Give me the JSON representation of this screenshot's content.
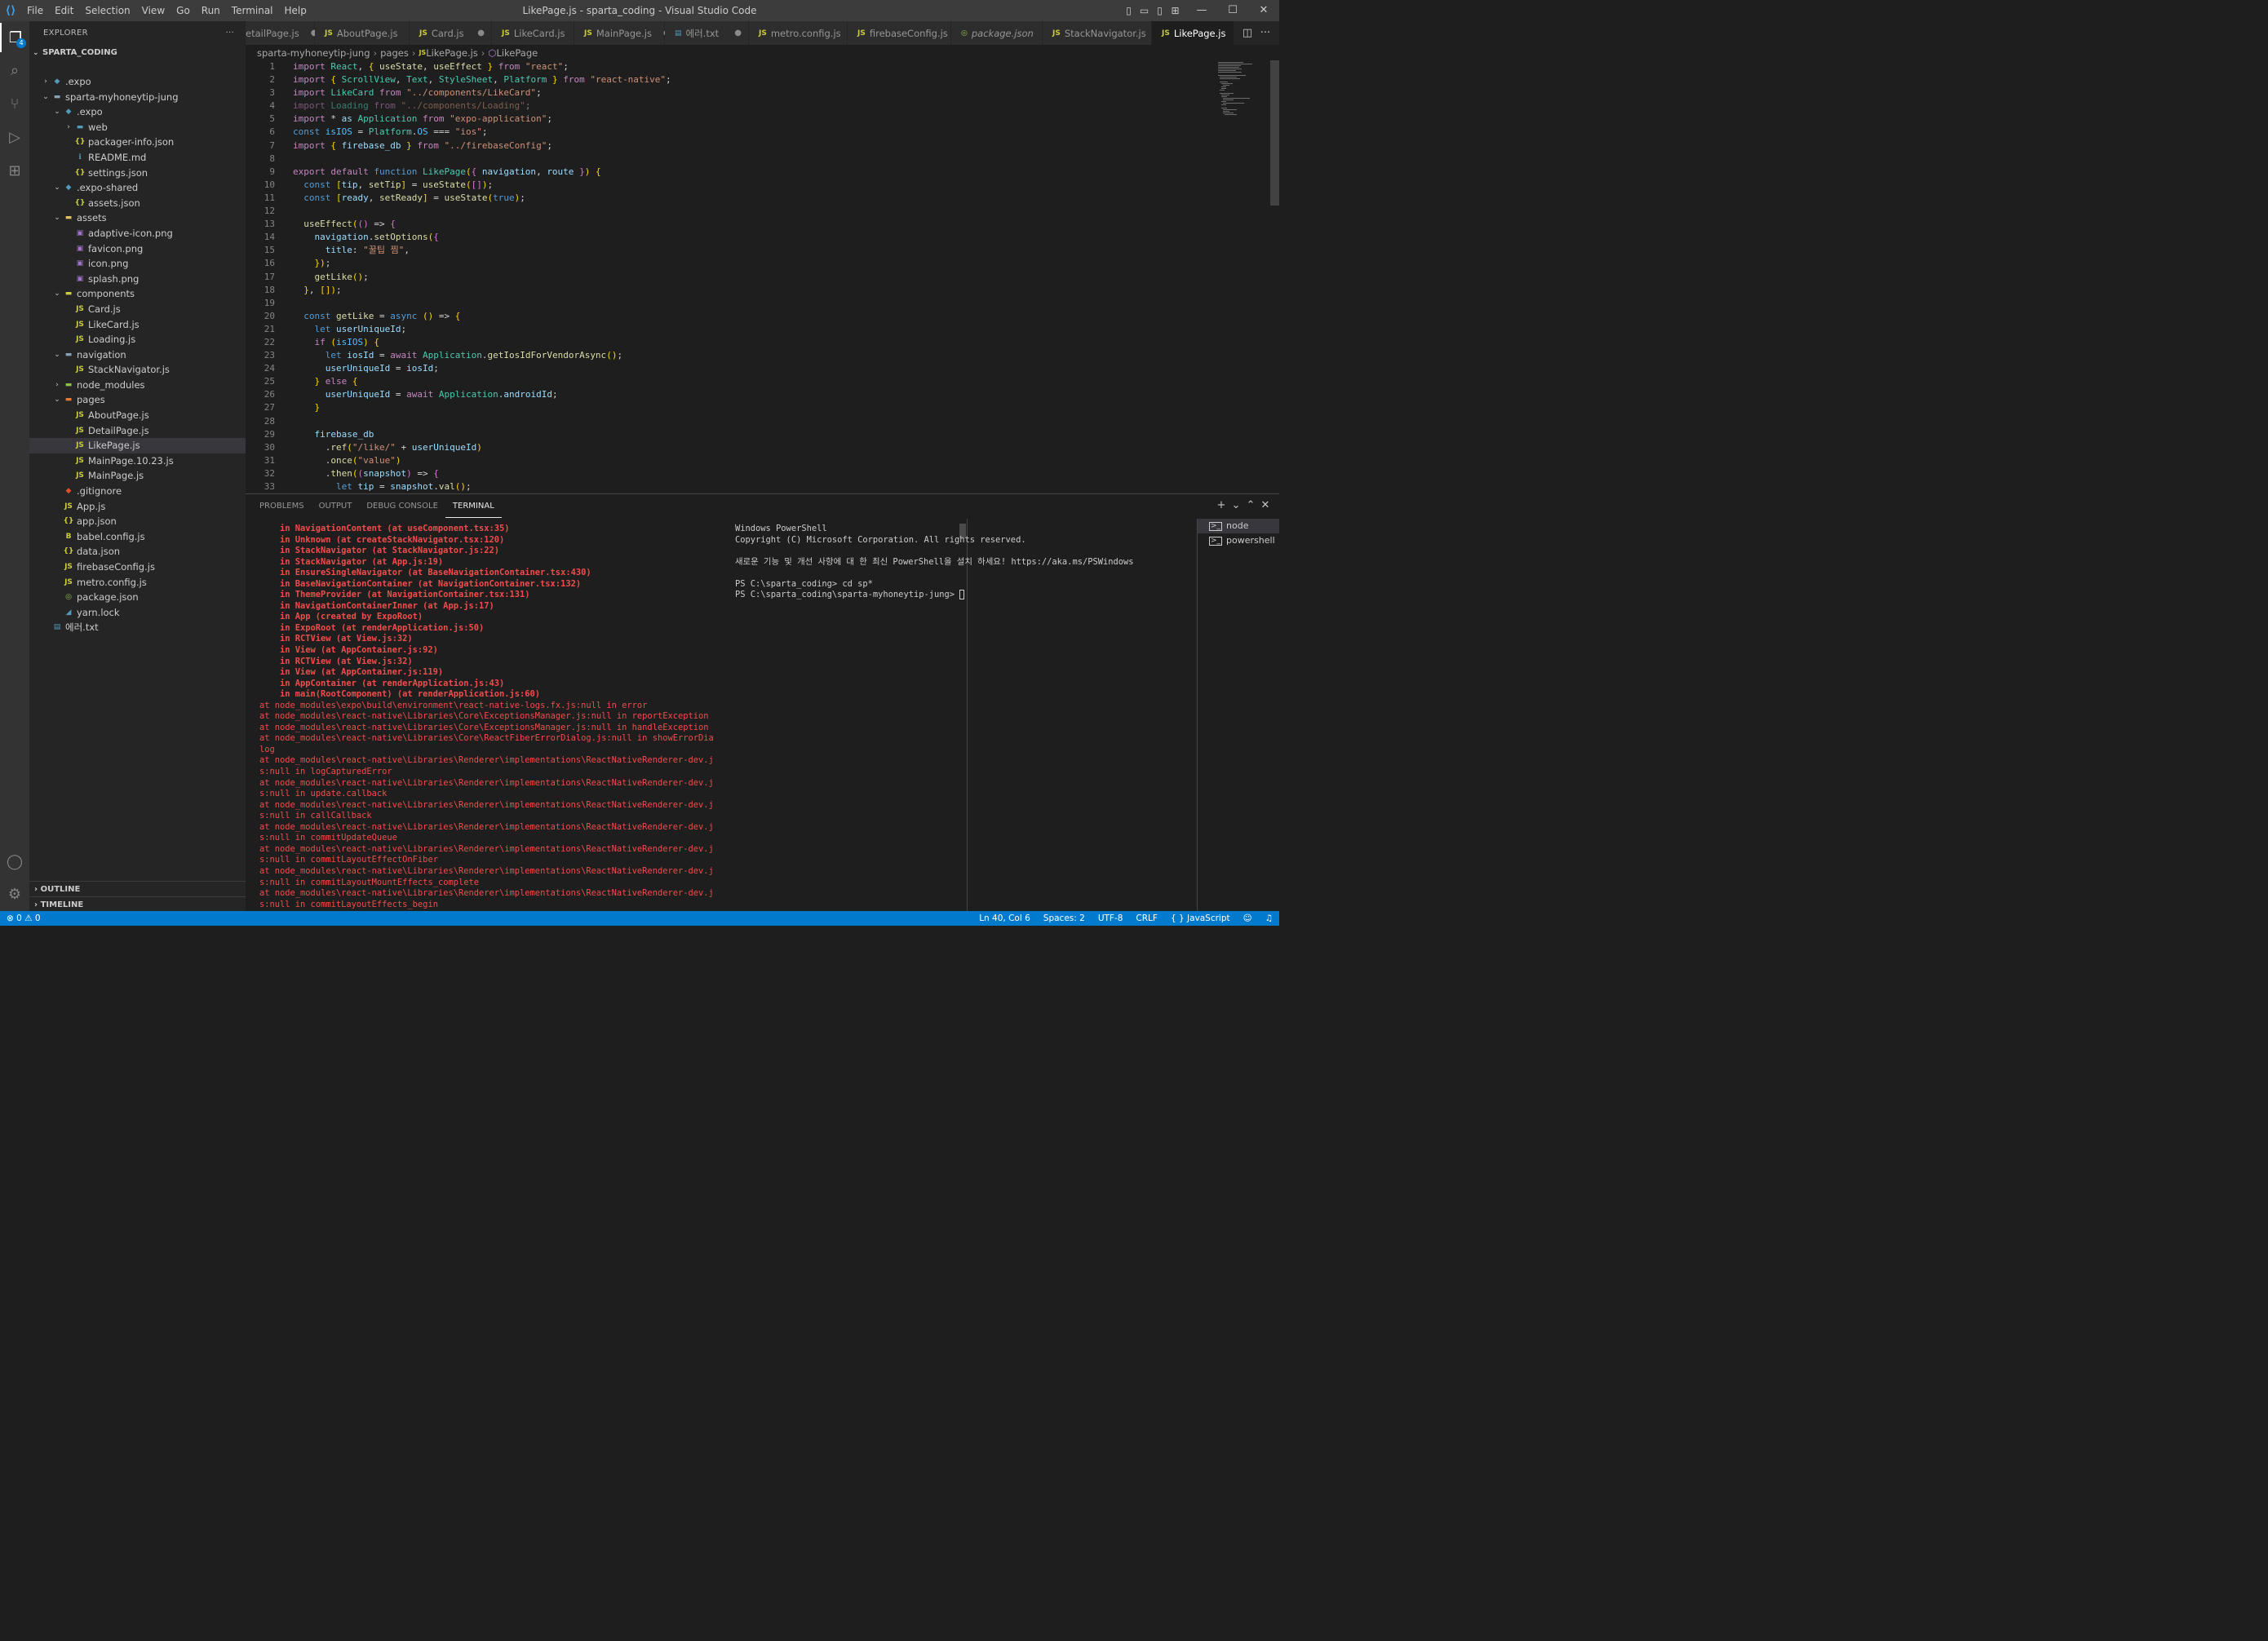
{
  "titlebar": {
    "title": "LikePage.js - sparta_coding - Visual Studio Code",
    "menu": [
      "File",
      "Edit",
      "Selection",
      "View",
      "Go",
      "Run",
      "Terminal",
      "Help"
    ]
  },
  "activity": {
    "badge": "4"
  },
  "sidebar": {
    "header": "EXPLORER",
    "more": "···",
    "root": "SPARTA_CODING",
    "tree": [
      {
        "label": ".expo",
        "chev": "›",
        "icon": "◆",
        "color": "#519aba",
        "depth": 0
      },
      {
        "label": "sparta-myhoneytip-jung",
        "chev": "⌄",
        "icon": "▬",
        "color": "#8aa0b3",
        "depth": 0
      },
      {
        "label": ".expo",
        "chev": "⌄",
        "icon": "◆",
        "color": "#519aba",
        "depth": 1
      },
      {
        "label": "web",
        "chev": "›",
        "icon": "▬",
        "color": "#519aba",
        "depth": 2
      },
      {
        "label": "packager-info.json",
        "chev": "",
        "icon": "{}",
        "color": "#cbcb41",
        "depth": 2
      },
      {
        "label": "README.md",
        "chev": "",
        "icon": "ℹ",
        "color": "#519aba",
        "depth": 2
      },
      {
        "label": "settings.json",
        "chev": "",
        "icon": "{}",
        "color": "#cbcb41",
        "depth": 2
      },
      {
        "label": ".expo-shared",
        "chev": "⌄",
        "icon": "◆",
        "color": "#519aba",
        "depth": 1
      },
      {
        "label": "assets.json",
        "chev": "",
        "icon": "{}",
        "color": "#cbcb41",
        "depth": 2
      },
      {
        "label": "assets",
        "chev": "⌄",
        "icon": "▬",
        "color": "#e0c060",
        "depth": 1
      },
      {
        "label": "adaptive-icon.png",
        "chev": "",
        "icon": "▣",
        "color": "#a074c4",
        "depth": 2
      },
      {
        "label": "favicon.png",
        "chev": "",
        "icon": "▣",
        "color": "#a074c4",
        "depth": 2
      },
      {
        "label": "icon.png",
        "chev": "",
        "icon": "▣",
        "color": "#a074c4",
        "depth": 2
      },
      {
        "label": "splash.png",
        "chev": "",
        "icon": "▣",
        "color": "#a074c4",
        "depth": 2
      },
      {
        "label": "components",
        "chev": "⌄",
        "icon": "▬",
        "color": "#cbcb41",
        "depth": 1
      },
      {
        "label": "Card.js",
        "chev": "",
        "icon": "JS",
        "color": "#cbcb41",
        "depth": 2
      },
      {
        "label": "LikeCard.js",
        "chev": "",
        "icon": "JS",
        "color": "#cbcb41",
        "depth": 2
      },
      {
        "label": "Loading.js",
        "chev": "",
        "icon": "JS",
        "color": "#cbcb41",
        "depth": 2
      },
      {
        "label": "navigation",
        "chev": "⌄",
        "icon": "▬",
        "color": "#8aa0b3",
        "depth": 1
      },
      {
        "label": "StackNavigator.js",
        "chev": "",
        "icon": "JS",
        "color": "#cbcb41",
        "depth": 2
      },
      {
        "label": "node_modules",
        "chev": "›",
        "icon": "▬",
        "color": "#8dc149",
        "depth": 1
      },
      {
        "label": "pages",
        "chev": "⌄",
        "icon": "▬",
        "color": "#e37933",
        "depth": 1
      },
      {
        "label": "AboutPage.js",
        "chev": "",
        "icon": "JS",
        "color": "#cbcb41",
        "depth": 2
      },
      {
        "label": "DetailPage.js",
        "chev": "",
        "icon": "JS",
        "color": "#cbcb41",
        "depth": 2
      },
      {
        "label": "LikePage.js",
        "chev": "",
        "icon": "JS",
        "color": "#cbcb41",
        "depth": 2,
        "selected": true
      },
      {
        "label": "MainPage.10.23.js",
        "chev": "",
        "icon": "JS",
        "color": "#cbcb41",
        "depth": 2
      },
      {
        "label": "MainPage.js",
        "chev": "",
        "icon": "JS",
        "color": "#cbcb41",
        "depth": 2
      },
      {
        "label": ".gitignore",
        "chev": "",
        "icon": "◆",
        "color": "#e44d26",
        "depth": 1
      },
      {
        "label": "App.js",
        "chev": "",
        "icon": "JS",
        "color": "#cbcb41",
        "depth": 1
      },
      {
        "label": "app.json",
        "chev": "",
        "icon": "{}",
        "color": "#cbcb41",
        "depth": 1
      },
      {
        "label": "babel.config.js",
        "chev": "",
        "icon": "B",
        "color": "#cbcb41",
        "depth": 1
      },
      {
        "label": "data.json",
        "chev": "",
        "icon": "{}",
        "color": "#cbcb41",
        "depth": 1
      },
      {
        "label": "firebaseConfig.js",
        "chev": "",
        "icon": "JS",
        "color": "#cbcb41",
        "depth": 1
      },
      {
        "label": "metro.config.js",
        "chev": "",
        "icon": "JS",
        "color": "#cbcb41",
        "depth": 1
      },
      {
        "label": "package.json",
        "chev": "",
        "icon": "◎",
        "color": "#8dc149",
        "depth": 1
      },
      {
        "label": "yarn.lock",
        "chev": "",
        "icon": "◢",
        "color": "#519aba",
        "depth": 1
      },
      {
        "label": "에러.txt",
        "chev": "",
        "icon": "▤",
        "color": "#519aba",
        "depth": 0
      }
    ],
    "outline": "OUTLINE",
    "timeline": "TIMELINE"
  },
  "tabs": [
    {
      "label": "etailPage.js",
      "dot": true,
      "icon": "JS"
    },
    {
      "label": "AboutPage.js",
      "dot": false,
      "icon": "JS"
    },
    {
      "label": "Card.js",
      "dot": true,
      "icon": "JS"
    },
    {
      "label": "LikeCard.js",
      "dot": false,
      "icon": "JS"
    },
    {
      "label": "MainPage.js",
      "dot": true,
      "icon": "JS"
    },
    {
      "label": "에러.txt",
      "dot": true,
      "icon": "▤"
    },
    {
      "label": "metro.config.js",
      "dot": false,
      "icon": "JS"
    },
    {
      "label": "firebaseConfig.js",
      "dot": false,
      "icon": "JS"
    },
    {
      "label": "package.json",
      "dot": false,
      "icon": "◎"
    },
    {
      "label": "StackNavigator.js",
      "dot": false,
      "icon": "JS"
    },
    {
      "label": "LikePage.js",
      "dot": false,
      "icon": "JS",
      "active": true
    }
  ],
  "breadcrumb": [
    "sparta-myhoneytip-jung",
    "pages",
    "LikePage.js",
    "LikePage"
  ],
  "code_lines": [
    "import React, { useState, useEffect } from \"react\";",
    "import { ScrollView, Text, StyleSheet, Platform } from \"react-native\";",
    "import LikeCard from \"../components/LikeCard\";",
    "import Loading from \"../components/Loading\";",
    "import * as Application from \"expo-application\";",
    "const isIOS = Platform.OS === \"ios\";",
    "import { firebase_db } from \"../firebaseConfig\";",
    "",
    "export default function LikePage({ navigation, route }) {",
    "  const [tip, setTip] = useState([]);",
    "  const [ready, setReady] = useState(true);",
    "",
    "  useEffect(() => {",
    "    navigation.setOptions({",
    "      title: \"꿀팁 찜\",",
    "    });",
    "    getLike();",
    "  }, []);",
    "",
    "  const getLike = async () => {",
    "    let userUniqueId;",
    "    if (isIOS) {",
    "      let iosId = await Application.getIosIdForVendorAsync();",
    "      userUniqueId = iosId;",
    "    } else {",
    "      userUniqueId = await Application.androidId;",
    "    }",
    "",
    "    firebase_db",
    "      .ref(\"/like/\" + userUniqueId)",
    "      .once(\"value\")",
    "      .then((snapshot) => {",
    "        let tip = snapshot.val();"
  ],
  "panel": {
    "tabs": [
      "PROBLEMS",
      "OUTPUT",
      "DEBUG CONSOLE",
      "TERMINAL"
    ],
    "terminal_error": [
      "in NavigationContent (at useComponent.tsx:35)",
      "in Unknown (at createStackNavigator.tsx:120)",
      "in StackNavigator (at StackNavigator.js:22)",
      "in StackNavigator (at App.js:19)",
      "in EnsureSingleNavigator (at BaseNavigationContainer.tsx:430)",
      "in BaseNavigationContainer (at NavigationContainer.tsx:132)",
      "in ThemeProvider (at NavigationContainer.tsx:131)",
      "in NavigationContainerInner (at App.js:17)",
      "in App (created by ExpoRoot)",
      "in ExpoRoot (at renderApplication.js:50)",
      "in RCTView (at View.js:32)",
      "in View (at AppContainer.js:92)",
      "in RCTView (at View.js:32)",
      "in View (at AppContainer.js:119)",
      "in AppContainer (at renderApplication.js:43)",
      "in main(RootComponent) (at renderApplication.js:60)",
      "at node_modules\\expo\\build\\environment\\react-native-logs.fx.js:null in error",
      "at node_modules\\react-native\\Libraries\\Core\\ExceptionsManager.js:null in reportException",
      "at node_modules\\react-native\\Libraries\\Core\\ExceptionsManager.js:null in handleException",
      "at node_modules\\react-native\\Libraries\\Core\\ReactFiberErrorDialog.js:null in showErrorDia",
      "log",
      "at node_modules\\react-native\\Libraries\\Renderer\\implementations\\ReactNativeRenderer-dev.j",
      "s:null in logCapturedError",
      "at node_modules\\react-native\\Libraries\\Renderer\\implementations\\ReactNativeRenderer-dev.j",
      "s:null in update.callback",
      "at node_modules\\react-native\\Libraries\\Renderer\\implementations\\ReactNativeRenderer-dev.j",
      "s:null in callCallback",
      "at node_modules\\react-native\\Libraries\\Renderer\\implementations\\ReactNativeRenderer-dev.j",
      "s:null in commitUpdateQueue",
      "at node_modules\\react-native\\Libraries\\Renderer\\implementations\\ReactNativeRenderer-dev.j",
      "s:null in commitLayoutEffectOnFiber",
      "at node_modules\\react-native\\Libraries\\Renderer\\implementations\\ReactNativeRenderer-dev.j",
      "s:null in commitLayoutMountEffects_complete",
      "at node_modules\\react-native\\Libraries\\Renderer\\implementations\\ReactNativeRenderer-dev.j",
      "s:null in commitLayoutEffects_begin"
    ],
    "terminal_ps": [
      "Windows PowerShell",
      "Copyright (C) Microsoft Corporation. All rights reserved.",
      "",
      "새로운 기능 및 개선 사항에 대 한 최신 PowerShell을 설치 하세요! https://aka.ms/PSWindows",
      "",
      "PS C:\\sparta_coding> cd sp*",
      "PS C:\\sparta_coding\\sparta-myhoneytip-jung> "
    ],
    "terminals": [
      "node",
      "powershell"
    ]
  },
  "status": {
    "problems": "⊗ 0 ⚠ 0",
    "position": "Ln 40, Col 6",
    "spaces": "Spaces: 2",
    "encoding": "UTF-8",
    "eol": "CRLF",
    "language": "{ } JavaScript"
  }
}
